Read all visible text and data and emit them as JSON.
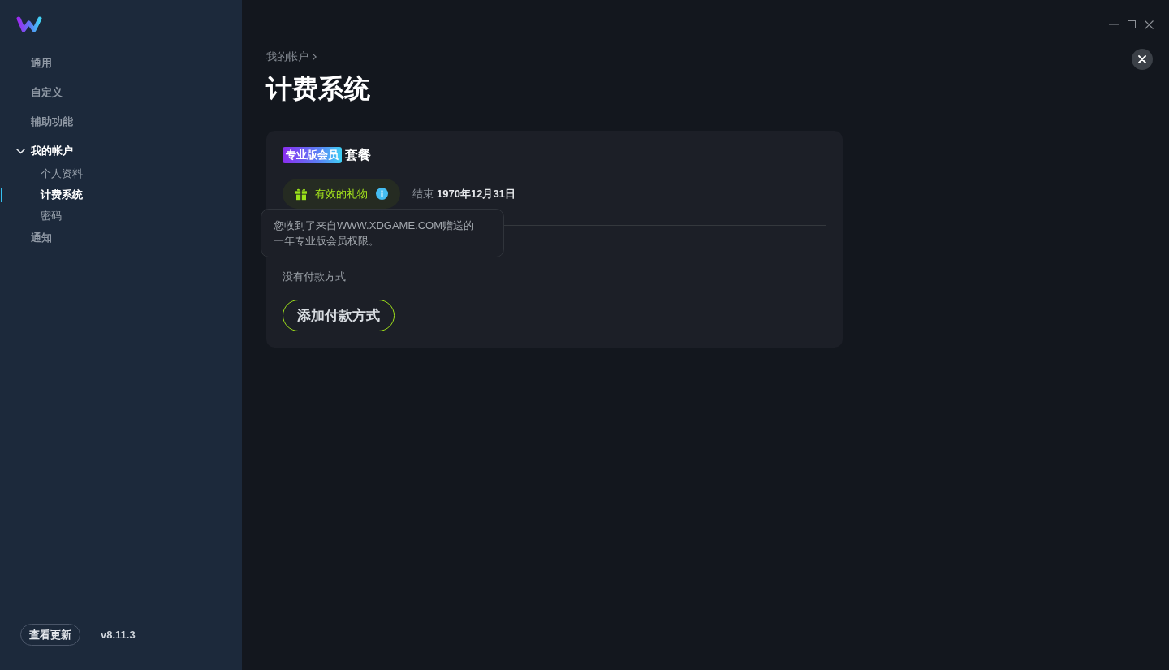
{
  "sidebar": {
    "items": [
      {
        "label": "通用",
        "selected": false
      },
      {
        "label": "自定义",
        "selected": false
      },
      {
        "label": "辅助功能",
        "selected": false
      },
      {
        "label": "我的帐户",
        "selected": false,
        "expanded": true,
        "children": [
          {
            "label": "个人资料",
            "selected": false
          },
          {
            "label": "计费系统",
            "selected": true
          },
          {
            "label": "密码",
            "selected": false
          }
        ]
      },
      {
        "label": "通知",
        "selected": false
      }
    ],
    "update_button": "查看更新",
    "version": "v8.11.3"
  },
  "breadcrumb": [
    "我的帐户"
  ],
  "page_title": "计费系统",
  "plan": {
    "badge": "专业版会员",
    "label": "套餐",
    "gift_status": "有效的礼物",
    "end_label": "结束",
    "end_date": "1970年12月31日",
    "tooltip": "您收到了来自WWW.XDGAME.COM赠送的一年专业版会员权限。"
  },
  "payment": {
    "empty_text": "没有付款方式",
    "add_button": "添加付款方式"
  }
}
